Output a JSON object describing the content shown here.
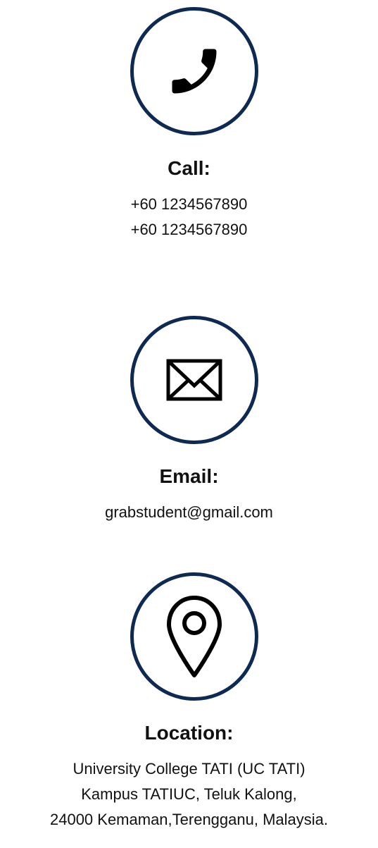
{
  "call": {
    "icon": "phone-icon",
    "heading": "Call:",
    "lines": [
      "+60 1234567890",
      "+60 1234567890"
    ]
  },
  "email": {
    "icon": "envelope-icon",
    "heading": "Email:",
    "lines": [
      "grabstudent@gmail.com"
    ]
  },
  "location": {
    "icon": "map-pin-icon",
    "heading": "Location:",
    "lines": [
      "University College TATI (UC TATI)",
      "Kampus TATIUC, Teluk Kalong,",
      "24000 Kemaman,Terengganu, Malaysia."
    ]
  },
  "colors": {
    "circle_border": "#0e2a52",
    "text": "#111111",
    "background": "#ffffff"
  }
}
